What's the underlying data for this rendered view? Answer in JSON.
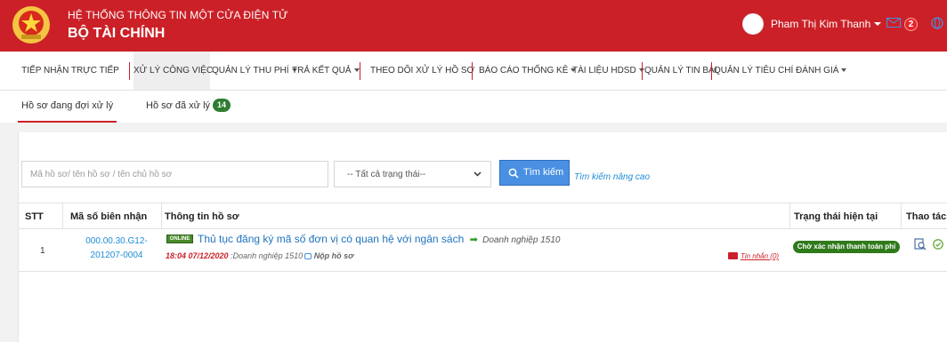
{
  "header": {
    "system_name": "HỆ THỐNG THÔNG TIN MỘT CỬA ĐIỆN TỬ",
    "ministry": "BỘ TÀI CHÍNH",
    "user_name": "Pham Thị Kim Thanh",
    "notification_count": "2",
    "accent_color": "#cb2027"
  },
  "nav": {
    "items": [
      {
        "label": "TIẾP NHẬN TRỰC TIẾP",
        "dropdown": false
      },
      {
        "label": "XỬ LÝ CÔNG VIỆC",
        "dropdown": false
      },
      {
        "label": "QUẢN LÝ THU PHÍ",
        "dropdown": true
      },
      {
        "label": "TRẢ KẾT QUẢ",
        "dropdown": true
      },
      {
        "label": "THEO DÕI XỬ LÝ HỒ SƠ",
        "dropdown": false
      },
      {
        "label": "BÁO CÁO THỐNG KÊ",
        "dropdown": true
      },
      {
        "label": "TÀI LIỆU HDSD",
        "dropdown": true
      },
      {
        "label": "QUẢN LÝ TIN BÀI",
        "dropdown": false
      },
      {
        "label": "QUẢN LÝ TIÊU CHÍ ĐÁNH GIÁ",
        "dropdown": true
      }
    ]
  },
  "subtabs": {
    "pending": "Hồ sơ đang đợi xử lý",
    "processed": "Hồ sơ đã xử lý",
    "processed_count": "14"
  },
  "search": {
    "placeholder": "Mã hồ sơ/ tên hồ sơ / tên chủ hồ sơ",
    "status_selected": "-- Tất cả trạng thái--",
    "button_label": "Tìm kiếm",
    "advanced_link": "Tìm kiếm nâng cao"
  },
  "table": {
    "headers": {
      "stt": "STT",
      "code": "Mã số biên nhận",
      "info": "Thông tin hồ sơ",
      "status": "Trạng thái hiện tại",
      "actions": "Thao tác"
    },
    "rows": [
      {
        "stt": "1",
        "code_line1": "000.00.30.G12-",
        "code_line2": "201207-0004",
        "online_badge": "ONLINE",
        "title": "Thủ tục đăng ký mã số đơn vị có quan hệ với ngân sách",
        "org": "Doanh nghiệp 1510",
        "time": "18:04 07/12/2020",
        "submitter": ":Doanh nghiệp 1510",
        "submit_label": "Nộp hồ sơ",
        "messages_link": "Tin nhắn (0)",
        "status": "Chờ xác nhận thanh toán phí"
      }
    ]
  }
}
